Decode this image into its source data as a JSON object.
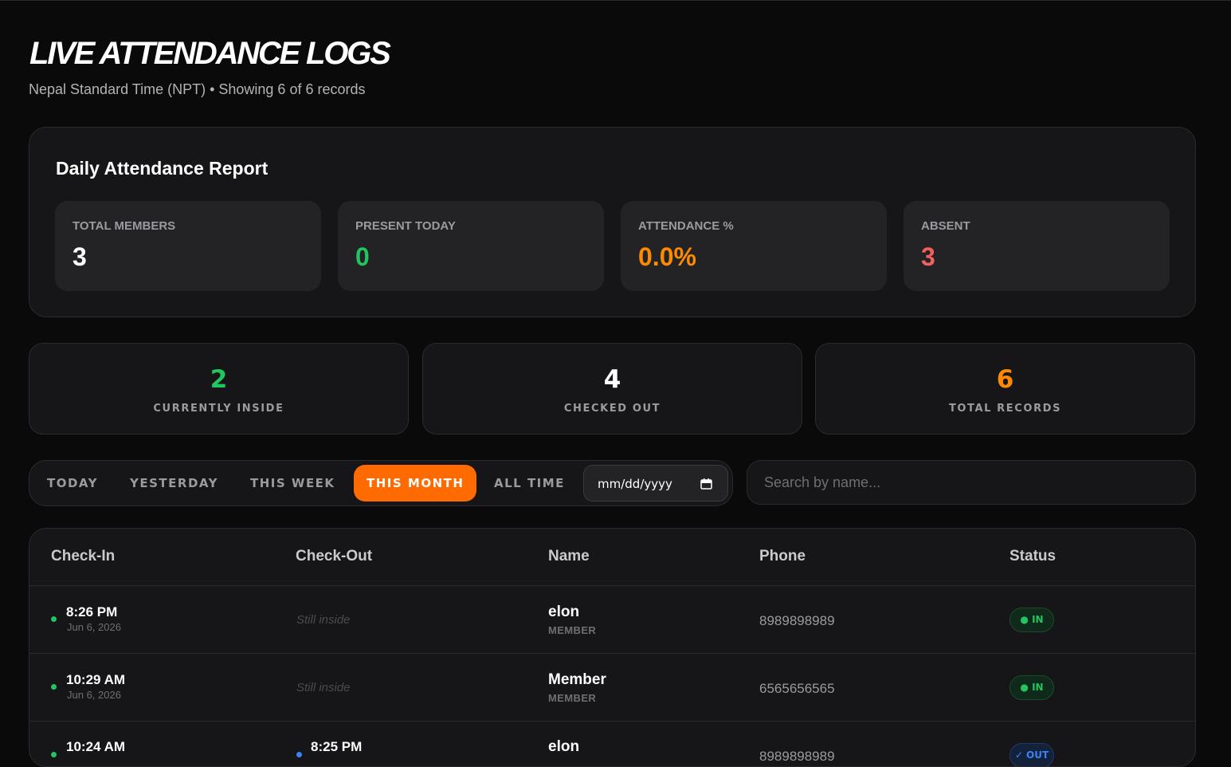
{
  "header": {
    "title": "LIVE ATTENDANCE LOGS",
    "subtitle": "Nepal Standard Time (NPT) • Showing 6 of 6 records"
  },
  "report": {
    "title": "Daily Attendance Report",
    "stats": [
      {
        "label": "TOTAL MEMBERS",
        "value": "3",
        "color": "#ffffff"
      },
      {
        "label": "PRESENT TODAY",
        "value": "0",
        "color": "#22c55e"
      },
      {
        "label": "ATTENDANCE %",
        "value": "0.0%",
        "color": "#ff8a00"
      },
      {
        "label": "ABSENT",
        "value": "3",
        "color": "#f25f5f"
      }
    ]
  },
  "summary": [
    {
      "value": "2",
      "label": "CURRENTLY INSIDE",
      "color": "#22c55e"
    },
    {
      "value": "4",
      "label": "CHECKED OUT",
      "color": "#ffffff"
    },
    {
      "value": "6",
      "label": "TOTAL RECORDS",
      "color": "#ff8a00"
    }
  ],
  "filters": {
    "buttons": [
      "TODAY",
      "YESTERDAY",
      "THIS WEEK",
      "THIS MONTH",
      "ALL TIME"
    ],
    "active": "THIS MONTH",
    "date_placeholder": "mm/dd/yyyy"
  },
  "search": {
    "placeholder": "Search by name..."
  },
  "table": {
    "columns": [
      "Check-In",
      "Check-Out",
      "Name",
      "Phone",
      "Status"
    ],
    "rows": [
      {
        "checkin_time": "8:26 PM",
        "checkin_date": "Jun 6, 2026",
        "checkout": "Still inside",
        "name": "elon",
        "role": "MEMBER",
        "phone": "8989898989",
        "status": "● IN"
      },
      {
        "checkin_time": "10:29 AM",
        "checkin_date": "Jun 6, 2026",
        "checkout": "Still inside",
        "name": "Member",
        "role": "MEMBER",
        "phone": "6565656565",
        "status": "● IN"
      },
      {
        "checkin_time": "10:24 AM",
        "checkout_time": "8:25 PM",
        "name": "elon",
        "phone": "8989898989",
        "status": "✓ OUT"
      }
    ]
  },
  "colors": {
    "accent": "#ff6b00",
    "in_dot": "#22c55e",
    "out_dot": "#3b82f6"
  }
}
